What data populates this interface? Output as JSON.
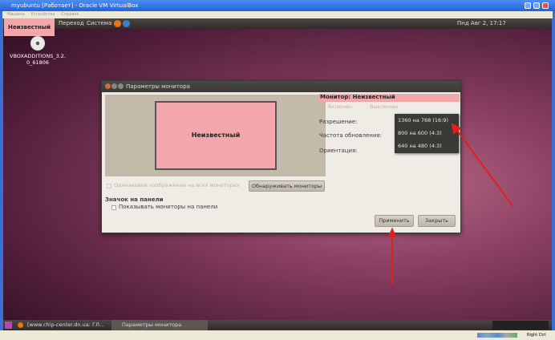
{
  "window": {
    "title": "myubuntu [Работает] - Oracle VM VirtualBox",
    "menu": [
      "Машина",
      "Устройства",
      "Справка"
    ]
  },
  "top_panel": {
    "tooltip": "Неизвестный",
    "menus": [
      "Переход",
      "Система"
    ],
    "clock": "Пнд Авг  2, 17:17"
  },
  "desktop": {
    "icon_label": "VBOXADDITIONS_3.2.0_61806"
  },
  "dialog": {
    "title": "Параметры монитора",
    "monitor_name": "Неизвестный",
    "mirror_label": "Одинаковое изображение на всех мониторах",
    "detect_button": "Обнаруживать мониторы",
    "panel_section": "Значок на панели",
    "show_in_panel": "Показывать мониторы на панели",
    "monitor_header": "Монитор: Неизвестный",
    "on_label": "Включен",
    "off_label": "Выключен",
    "resolution_label": "Разрешение:",
    "refresh_label": "Частота обновления:",
    "orientation_label": "Ориентация:",
    "resolution_options": [
      "1360 на 768 (16:9)",
      "800 на 600 (4:3)",
      "640 на 480 (4:3)"
    ],
    "apply_button": "Применить",
    "close_button": "Закрыть"
  },
  "taskbar": {
    "items": [
      "[www.chip-center.dn.ua: ГЛ...",
      "Параметры монитора"
    ]
  },
  "statusbar": {
    "host_key": "Right Ctrl"
  },
  "colors": {
    "highlight": "#f4a7ab",
    "arrow": "#e02020"
  }
}
